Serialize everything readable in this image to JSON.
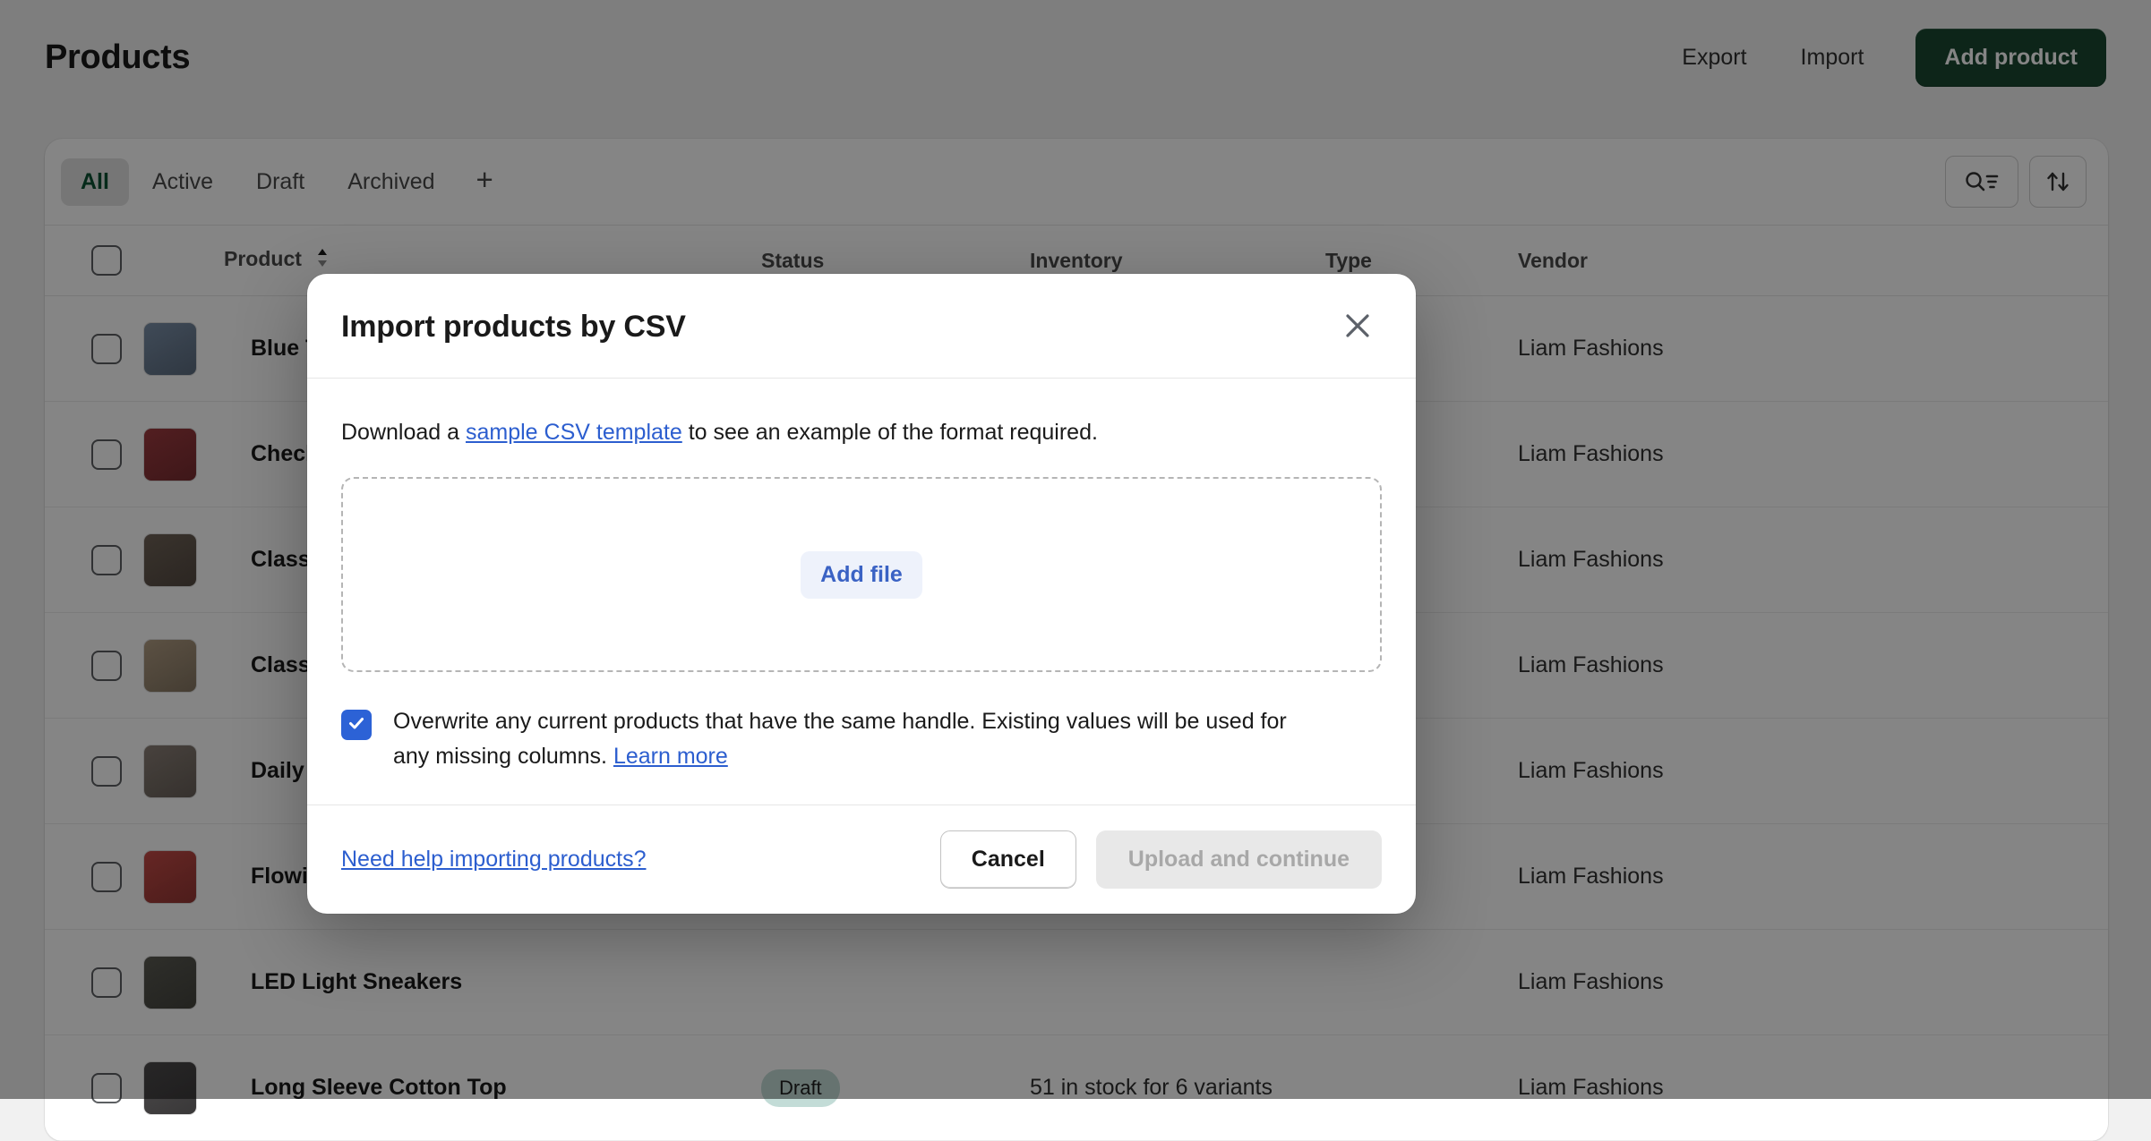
{
  "header": {
    "title": "Products",
    "export_label": "Export",
    "import_label": "Import",
    "add_product_label": "Add product",
    "primary_color": "#1a4731"
  },
  "tabs": {
    "items": [
      {
        "label": "All",
        "active": true
      },
      {
        "label": "Active",
        "active": false
      },
      {
        "label": "Draft",
        "active": false
      },
      {
        "label": "Archived",
        "active": false
      }
    ],
    "add_label": "+",
    "search_icon": "search-filter-icon",
    "sort_icon": "sort-icon"
  },
  "table": {
    "columns": [
      "Product",
      "Status",
      "Inventory",
      "Type",
      "Vendor"
    ],
    "sort_indicator": "sort-arrows-icon",
    "rows": [
      {
        "name": "Blue Tuxedo Jacket",
        "status": "",
        "inventory": "",
        "type": "",
        "vendor": "Liam Fashions",
        "thumb": "#7a8fa8"
      },
      {
        "name": "Checked Flannel Shirt",
        "status": "",
        "inventory": "",
        "type": "",
        "vendor": "Liam Fashions",
        "thumb": "#9e3b40"
      },
      {
        "name": "Classic Leather Jacket",
        "status": "",
        "inventory": "",
        "type": "",
        "vendor": "Liam Fashions",
        "thumb": "#6f6257"
      },
      {
        "name": "Classic Varsity Jacket",
        "status": "",
        "inventory": "",
        "type": "",
        "vendor": "Liam Fashions",
        "thumb": "#b09c82"
      },
      {
        "name": "Daily Denim Jacket",
        "status": "",
        "inventory": "",
        "type": "",
        "vendor": "Liam Fashions",
        "thumb": "#8a7f76"
      },
      {
        "name": "Flowing Summer Dress",
        "status": "",
        "inventory": "",
        "type": "",
        "vendor": "Liam Fashions",
        "thumb": "#c44a46"
      },
      {
        "name": "LED Light Sneakers",
        "status": "",
        "inventory": "",
        "type": "",
        "vendor": "Liam Fashions",
        "thumb": "#5a5a52"
      },
      {
        "name": "Long Sleeve Cotton Top",
        "status": "Draft",
        "inventory": "51 in stock for 6 variants",
        "type": "",
        "vendor": "Liam Fashions",
        "thumb": "#4c4a4b"
      }
    ]
  },
  "modal": {
    "title": "Import products by CSV",
    "close_icon": "close-icon",
    "intro_prefix": "Download a ",
    "intro_link": "sample CSV template",
    "intro_suffix": " to see an example of the format required.",
    "add_file_label": "Add file",
    "overwrite_checked": true,
    "overwrite_text": "Overwrite any current products that have the same handle. Existing values will be used for any missing columns. ",
    "overwrite_link": "Learn more",
    "help_link": "Need help importing products?",
    "cancel_label": "Cancel",
    "upload_label": "Upload and continue",
    "link_color": "#2c5ecf",
    "checkbox_color": "#2c62d6"
  }
}
